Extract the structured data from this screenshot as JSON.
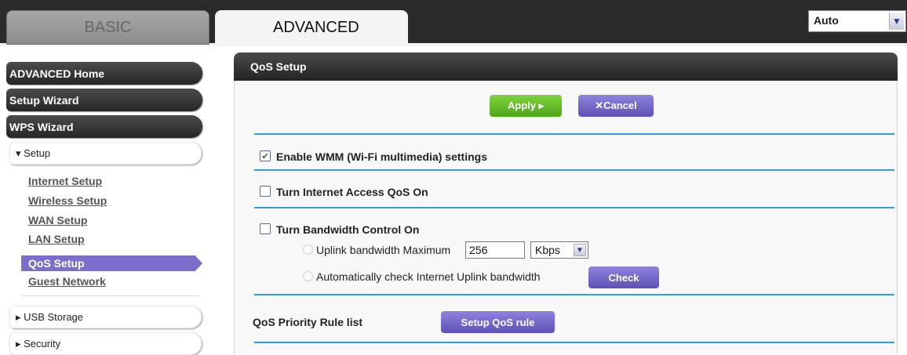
{
  "tabs": {
    "basic": "BASIC",
    "advanced": "ADVANCED"
  },
  "language": {
    "value": "Auto"
  },
  "sidebar": {
    "buttons": [
      "ADVANCED Home",
      "Setup Wizard",
      "WPS Wizard"
    ],
    "setup_section": "▾ Setup",
    "setup_links": [
      "Internet Setup",
      "Wireless Setup",
      "WAN Setup",
      "LAN Setup"
    ],
    "active_link": "QoS Setup",
    "after_links": [
      "Guest Network"
    ],
    "sections": [
      "▸ USB Storage",
      "▸ Security"
    ]
  },
  "panel": {
    "title": "QoS Setup",
    "apply_label": "Apply ▸",
    "cancel_label": "✕Cancel",
    "wmm_label": "Enable WMM (Wi-Fi multimedia) settings",
    "wmm_checked": true,
    "qos_label": "Turn Internet Access QoS On",
    "qos_checked": false,
    "bandwidth_label": "Turn Bandwidth Control On",
    "bandwidth_checked": false,
    "uplink_label": "Uplink bandwidth Maximum",
    "uplink_value": "256",
    "uplink_unit": "Kbps",
    "auto_label": "Automatically check Internet Uplink bandwidth",
    "check_label": "Check",
    "rule_list_label": "QoS Priority Rule list",
    "setup_rule_label": "Setup QoS rule"
  }
}
